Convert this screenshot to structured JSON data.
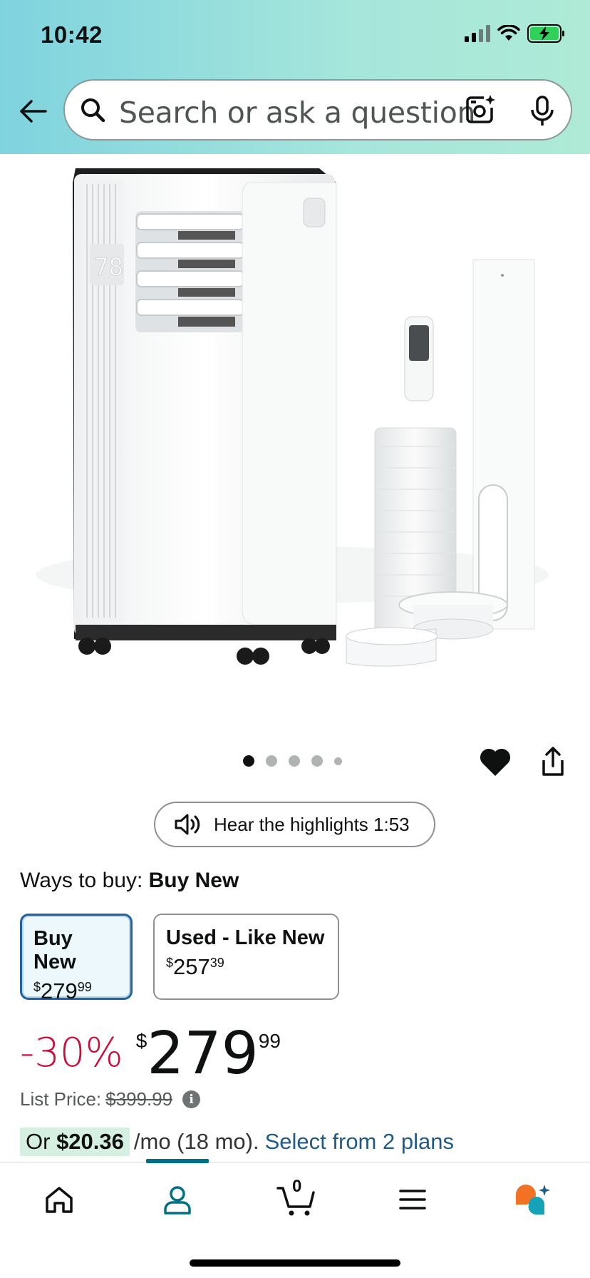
{
  "status": {
    "time": "10:42"
  },
  "search": {
    "placeholder": "Search or ask a question"
  },
  "carousel": {
    "dot_count": 5,
    "active_index": 0
  },
  "product_image": {
    "display_reading": "78"
  },
  "highlights": {
    "label": "Hear the highlights 1:53"
  },
  "ways_to_buy": {
    "label": "Ways to buy:",
    "selected": "Buy New"
  },
  "options": [
    {
      "title": "Buy New",
      "price_symbol": "$",
      "price_whole": "279",
      "price_fraction": "99",
      "selected": true
    },
    {
      "title": "Used - Like New",
      "price_symbol": "$",
      "price_whole": "257",
      "price_fraction": "39",
      "selected": false
    }
  ],
  "price": {
    "discount": "-30%",
    "symbol": "$",
    "whole": "279",
    "fraction": "99",
    "list_label": "List Price:",
    "list_value": "$399.99"
  },
  "financing": {
    "prefix": "Or",
    "amount": "$20.36",
    "term": "/mo (18 mo).",
    "link": "Select from 2 plans"
  },
  "nav": {
    "items": [
      "home",
      "account",
      "cart",
      "menu",
      "rufus"
    ],
    "cart_count": "0",
    "active": "account"
  },
  "colors": {
    "accent": "#007185",
    "deal_red": "#cc0c39",
    "link": "#1f5a8a",
    "selected_border": "#2162a1"
  }
}
